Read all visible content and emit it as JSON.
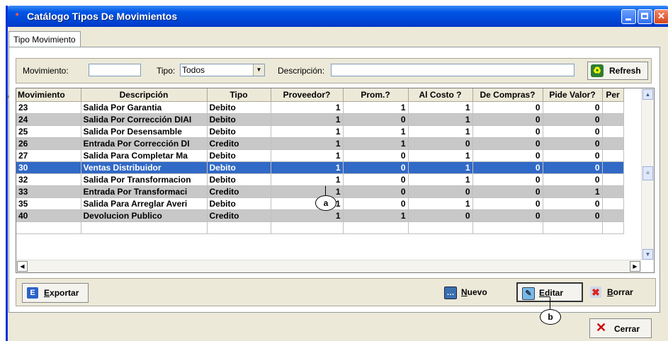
{
  "window": {
    "title": "Catálogo Tipos De Movimientos"
  },
  "tabs": [
    {
      "label": "Tipo Movimiento"
    }
  ],
  "filters": {
    "movimiento_label": "Movimiento:",
    "movimiento_value": "",
    "tipo_label": "Tipo:",
    "tipo_value": "Todos",
    "descripcion_label": "Descripción:",
    "descripcion_value": "",
    "refresh_label": "Refresh"
  },
  "grid": {
    "columns": [
      "Movimiento",
      "Descripción",
      "Tipo",
      "Proveedor?",
      "Prom.?",
      "Al Costo ?",
      "De Compras?",
      "Pide Valor?",
      "Per"
    ],
    "rows": [
      [
        "23",
        "Salida Por Garantia",
        "Debito",
        "1",
        "1",
        "1",
        "0",
        "0"
      ],
      [
        "24",
        "Salida Por Corrección DIAI",
        "Debito",
        "1",
        "0",
        "1",
        "0",
        "0"
      ],
      [
        "25",
        "Salida Por Desensamble",
        "Debito",
        "1",
        "1",
        "1",
        "0",
        "0"
      ],
      [
        "26",
        "Entrada Por Corrección DI",
        "Credito",
        "1",
        "1",
        "0",
        "0",
        "0"
      ],
      [
        "27",
        "Salida Para Completar Ma",
        "Debito",
        "1",
        "0",
        "1",
        "0",
        "0"
      ],
      [
        "30",
        "Ventas Distribuidor",
        "Debito",
        "1",
        "0",
        "1",
        "0",
        "0"
      ],
      [
        "32",
        "Salida Por Transformacion",
        "Debito",
        "1",
        "0",
        "1",
        "0",
        "0"
      ],
      [
        "33",
        "Entrada Por Transformaci",
        "Credito",
        "1",
        "0",
        "0",
        "0",
        "1"
      ],
      [
        "35",
        "Salida Para Arreglar Averi",
        "Debito",
        "1",
        "0",
        "1",
        "0",
        "0"
      ],
      [
        "40",
        "Devolucion Publico",
        "Credito",
        "1",
        "1",
        "0",
        "0",
        "0"
      ]
    ],
    "selected_row": 5
  },
  "buttons": {
    "exportar": {
      "pre": "E",
      "rest": "xportar"
    },
    "nuevo": {
      "pre": "N",
      "rest": "uevo"
    },
    "editar": {
      "pre": "Ed",
      "mid": "i",
      "rest": "tar"
    },
    "borrar": {
      "pre": "B",
      "rest": "orrar"
    },
    "cerrar": "Cerrar"
  },
  "callouts": {
    "a": "a",
    "b": "b"
  },
  "colors": {
    "title_bar": "#0055E5",
    "selection": "#3169C6",
    "alt_row": "#C8C8C8"
  }
}
